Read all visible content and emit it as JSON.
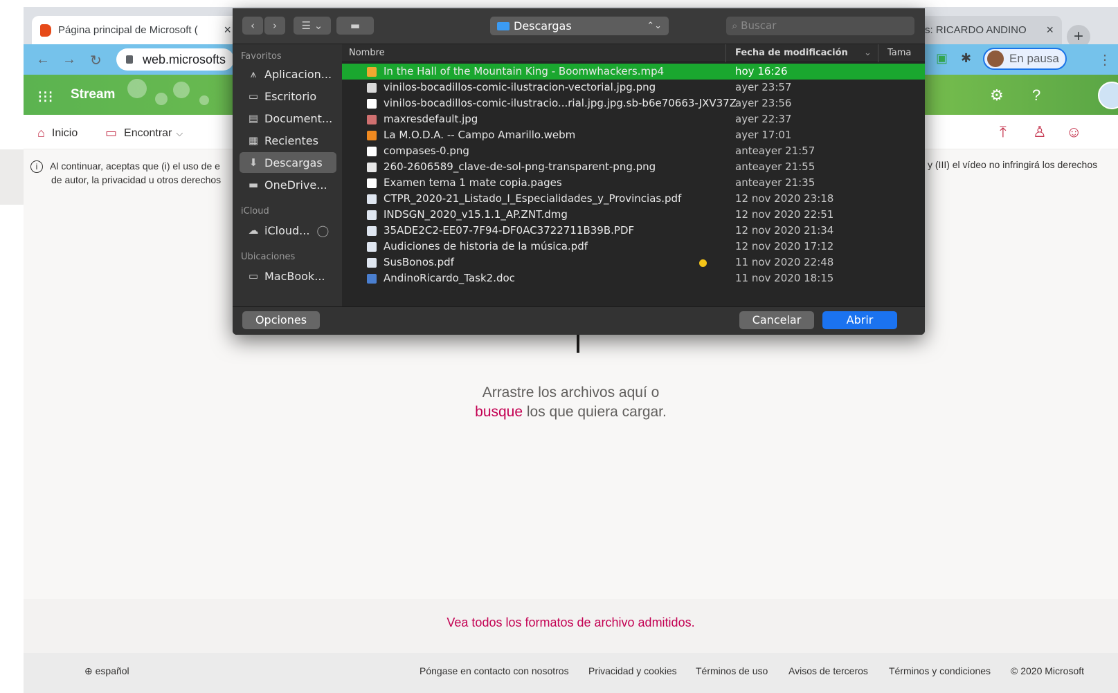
{
  "browser": {
    "tabs": [
      {
        "title": "Página principal de Microsoft (",
        "close": "×"
      },
      {
        "title": "s: RICARDO ANDINO",
        "close": "×"
      }
    ],
    "new_tab": "+",
    "url": "web.microsofts",
    "profile_label": "En pausa"
  },
  "stream": {
    "app_name": "Stream",
    "nav": [
      {
        "label": "Inicio"
      },
      {
        "label": "Encontrar"
      }
    ],
    "notice_left_line1": "Al continuar, aceptas que (i) el uso de e",
    "notice_left_line2": "de autor, la privacidad u otros derechos",
    "notice_right": "y (III) el vídeo no infringirá los derechos",
    "drop_line1": "Arrastre los archivos aquí o",
    "drop_link": "busque",
    "drop_line2_rest": " los que quiera cargar.",
    "formats_link": "Vea todos los formatos de archivo admitidos.",
    "footer": {
      "language": "español",
      "links": [
        "Póngase en contacto con nosotros",
        "Privacidad y cookies",
        "Términos de uso",
        "Avisos de terceros",
        "Términos y condiciones",
        "© 2020 Microsoft"
      ]
    }
  },
  "dialog": {
    "location": "Descargas",
    "search_placeholder": "Buscar",
    "sidebar": {
      "favorites_header": "Favoritos",
      "favorites": [
        "Aplicacion...",
        "Escritorio",
        "Document...",
        "Recientes",
        "Descargas",
        "OneDrive..."
      ],
      "selected": "Descargas",
      "icloud_header": "iCloud",
      "icloud": [
        "iCloud..."
      ],
      "locations_header": "Ubicaciones",
      "locations": [
        "MacBook..."
      ]
    },
    "columns": {
      "name": "Nombre",
      "date": "Fecha de modificación",
      "size": "Tama"
    },
    "files": [
      {
        "name": "In the Hall of the Mountain King - Boomwhackers.mp4",
        "date": "hoy 16:26",
        "selected": true
      },
      {
        "name": "vinilos-bocadillos-comic-ilustracion-vectorial.jpg.png",
        "date": "ayer 23:57"
      },
      {
        "name": "vinilos-bocadillos-comic-ilustracio...rial.jpg.jpg.sb-b6e70663-JXV37Z",
        "date": "ayer 23:56"
      },
      {
        "name": "maxresdefault.jpg",
        "date": "ayer 22:37"
      },
      {
        "name": "La M.O.D.A. -- Campo Amarillo.webm",
        "date": "ayer 17:01"
      },
      {
        "name": "compases-0.png",
        "date": "anteayer 21:57"
      },
      {
        "name": "260-2606589_clave-de-sol-png-transparent-png.png",
        "date": "anteayer 21:55"
      },
      {
        "name": "Examen tema 1 mate copia.pages",
        "date": "anteayer 21:35"
      },
      {
        "name": "CTPR_2020-21_Listado_I_Especialidades_y_Provincias.pdf",
        "date": "12 nov 2020 23:18"
      },
      {
        "name": "INDSGN_2020_v15.1.1_AP.ZNT.dmg",
        "date": "12 nov 2020 22:51"
      },
      {
        "name": "35ADE2C2-EE07-7F94-DF0AC3722711B39B.PDF",
        "date": "12 nov 2020 21:34"
      },
      {
        "name": "Audiciones de historia de la música.pdf",
        "date": "12 nov 2020 17:12"
      },
      {
        "name": "SusBonos.pdf",
        "date": "11 nov 2020 22:48",
        "tag": "yellow"
      },
      {
        "name": "AndinoRicardo_Task2.doc",
        "date": "11 nov 2020 18:15"
      }
    ],
    "buttons": {
      "options": "Opciones",
      "cancel": "Cancelar",
      "open": "Abrir"
    }
  },
  "colors": {
    "accent": "#c30052",
    "stream_green": "#6cb84c",
    "selection_green": "#1aa72f",
    "primary_button": "#1b73f0"
  }
}
